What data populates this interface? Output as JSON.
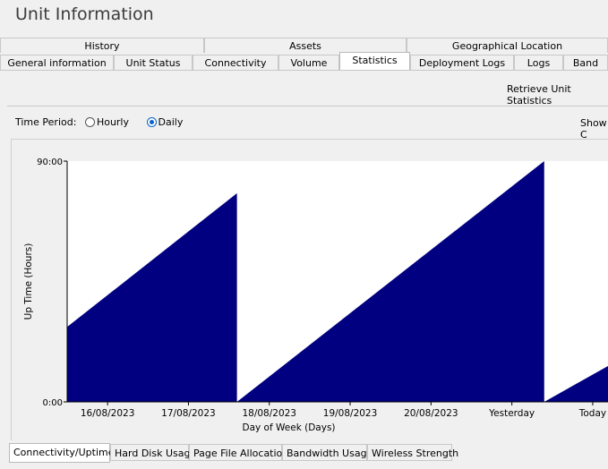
{
  "window": {
    "title": "Unit Information"
  },
  "tabs_top": [
    "History",
    "Assets",
    "Geographical Location"
  ],
  "tabs_bottom": [
    "General information",
    "Unit Status",
    "Connectivity",
    "Volume",
    "Statistics",
    "Deployment Logs",
    "Logs",
    "Band"
  ],
  "active_tab": "Statistics",
  "retrieve_label": "Retrieve Unit Statistics",
  "time_period": {
    "label": "Time Period:",
    "hourly": "Hourly",
    "daily": "Daily",
    "selected": "Daily"
  },
  "show_label": "Show C",
  "chart_data": {
    "type": "area",
    "ylabel": "Up Time (Hours)",
    "xlabel": "Day of Week (Days)",
    "yticks": [
      "0:00",
      "90:00"
    ],
    "ylim": [
      0,
      90
    ],
    "x_labels": [
      "16/08/2023",
      "17/08/2023",
      "18/08/2023",
      "19/08/2023",
      "20/08/2023",
      "Yesterday",
      "Today"
    ],
    "color": "#000080",
    "series": [
      {
        "points": [
          [
            0,
            28
          ],
          [
            2.1,
            78
          ]
        ]
      },
      {
        "points": [
          [
            2.1,
            0
          ],
          [
            5.9,
            90
          ]
        ]
      },
      {
        "points": [
          [
            5.9,
            0
          ],
          [
            6.9,
            17
          ]
        ]
      }
    ]
  },
  "bottom_tabs": [
    "Connectivity/Uptime",
    "Hard Disk Usage",
    "Page File Allocation",
    "Bandwidth Usage",
    "Wireless Strength"
  ],
  "active_bottom_tab": "Connectivity/Uptime"
}
